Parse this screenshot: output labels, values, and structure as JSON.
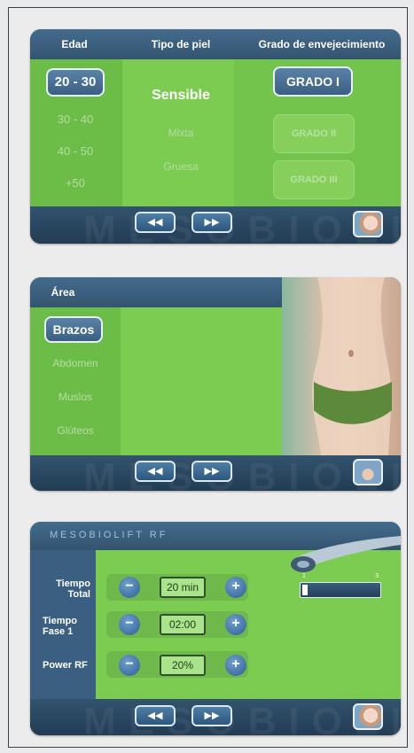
{
  "panel1": {
    "headers": [
      "Edad",
      "Tipo de piel",
      "Grado de envejecimiento"
    ],
    "edad": {
      "selected": "20 - 30",
      "options": [
        "30 - 40",
        "40 - 50",
        "+50"
      ]
    },
    "piel": {
      "selected": "Sensible",
      "options": [
        "Mixta",
        "Gruesa"
      ]
    },
    "grado": {
      "selected": "GRADO I",
      "options": [
        "GRADO II",
        "GRADO III"
      ]
    },
    "nav": {
      "prev": "◀◀",
      "next": "▶▶"
    },
    "watermark": "MESOBIOLIFT"
  },
  "panel2": {
    "header": "Área",
    "area": {
      "selected": "Brazos",
      "options": [
        "Abdomen",
        "Muslos",
        "Glúteos"
      ]
    },
    "nav": {
      "prev": "◀◀",
      "next": "▶▶"
    },
    "watermark": "MESOBIOLIFT"
  },
  "panel3": {
    "title": "MESOBIOLIFT RF",
    "rows": [
      {
        "label": "Tiempo Total",
        "value": "20 min"
      },
      {
        "label": "Tiempo Fase 1",
        "value": "02:00"
      },
      {
        "label": "Power RF",
        "value": "20%"
      }
    ],
    "minus": "−",
    "plus": "+",
    "scale": {
      "min": "1",
      "max": "3"
    },
    "nav": {
      "prev": "◀◀",
      "next": "▶▶"
    },
    "watermark": "MESOBIOLIFT"
  },
  "colors": {
    "green": "#7ccc52",
    "navy": "#2e4a63",
    "highlight": "#3a5f83"
  }
}
